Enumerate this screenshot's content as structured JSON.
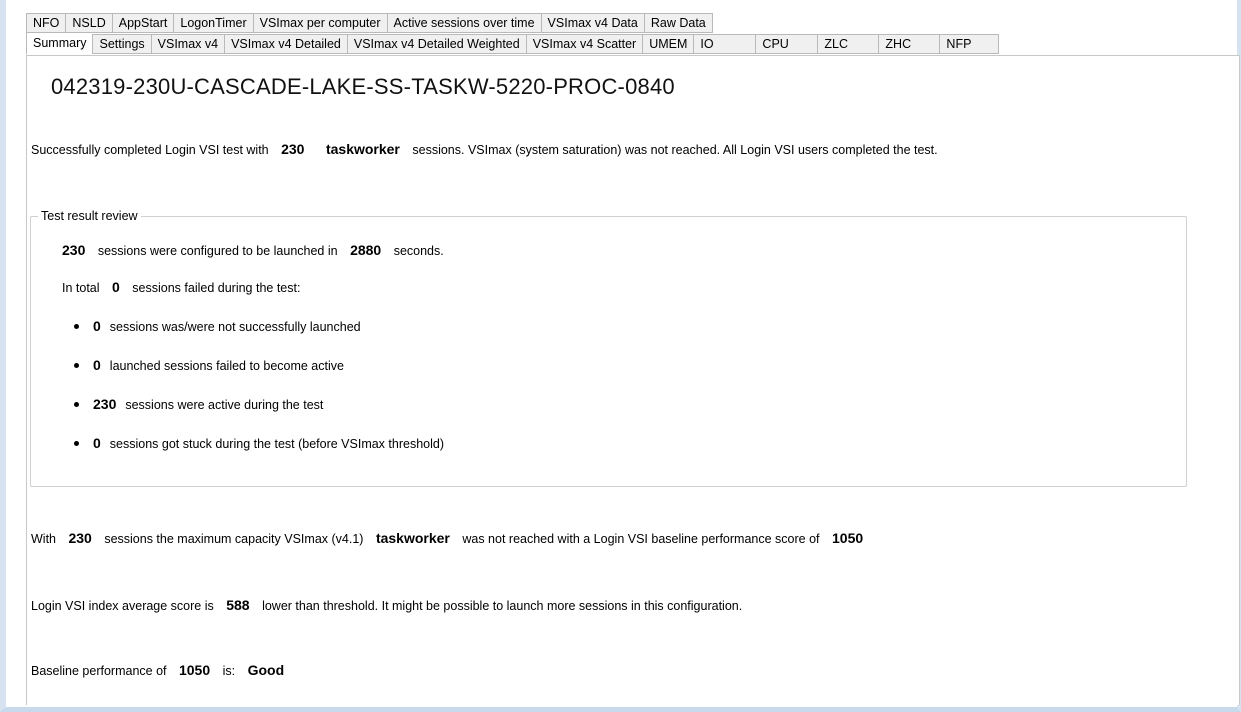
{
  "tabs_row1": [
    "NFO",
    "NSLD",
    "AppStart",
    "LogonTimer",
    "VSImax per computer",
    "Active sessions over time",
    "VSImax v4 Data",
    "Raw Data"
  ],
  "tabs_row2": [
    "Summary",
    "Settings",
    "VSImax v4",
    "VSImax v4 Detailed",
    "VSImax v4 Detailed Weighted",
    "VSImax v4 Scatter",
    "UMEM",
    "IO",
    "CPU",
    "ZLC",
    "ZHC",
    "NFP"
  ],
  "active_tab": "Summary",
  "summary": {
    "title": "042319-230U-CASCADE-LAKE-SS-TASKW-5220-PROC-0840",
    "completion": {
      "prefix": "Successfully completed Login VSI test with",
      "sessions": "230",
      "workload": "taskworker",
      "suffix": "sessions. VSImax (system saturation) was not reached. All Login VSI users completed the test."
    },
    "review": {
      "legend": "Test result review",
      "configured_sessions": "230",
      "configured_text": "sessions were configured to be launched in",
      "launch_seconds": "2880",
      "seconds_text": "seconds.",
      "total_prefix": "In total",
      "failed_total": "0",
      "failed_text": "sessions failed during the test:",
      "bullets": [
        {
          "value": "0",
          "text": "sessions was/were not successfully launched"
        },
        {
          "value": "0",
          "text": "launched sessions failed to become active"
        },
        {
          "value": "230",
          "text": "sessions were active during the test"
        },
        {
          "value": "0",
          "text": "sessions got stuck during the test (before VSImax threshold)"
        }
      ]
    },
    "capacity": {
      "prefix": "With",
      "sessions": "230",
      "middle": "sessions the maximum capacity VSImax (v4.1)",
      "workload": "taskworker",
      "suffix": "was not reached with a Login VSI baseline performance score of",
      "baseline": "1050"
    },
    "index": {
      "prefix": "Login VSI index average score is",
      "score": "588",
      "suffix": "lower than threshold. It might be possible to launch more sessions in this configuration."
    },
    "baseline": {
      "prefix": "Baseline performance of",
      "value": "1050",
      "middle": "is:",
      "rating": "Good"
    }
  }
}
